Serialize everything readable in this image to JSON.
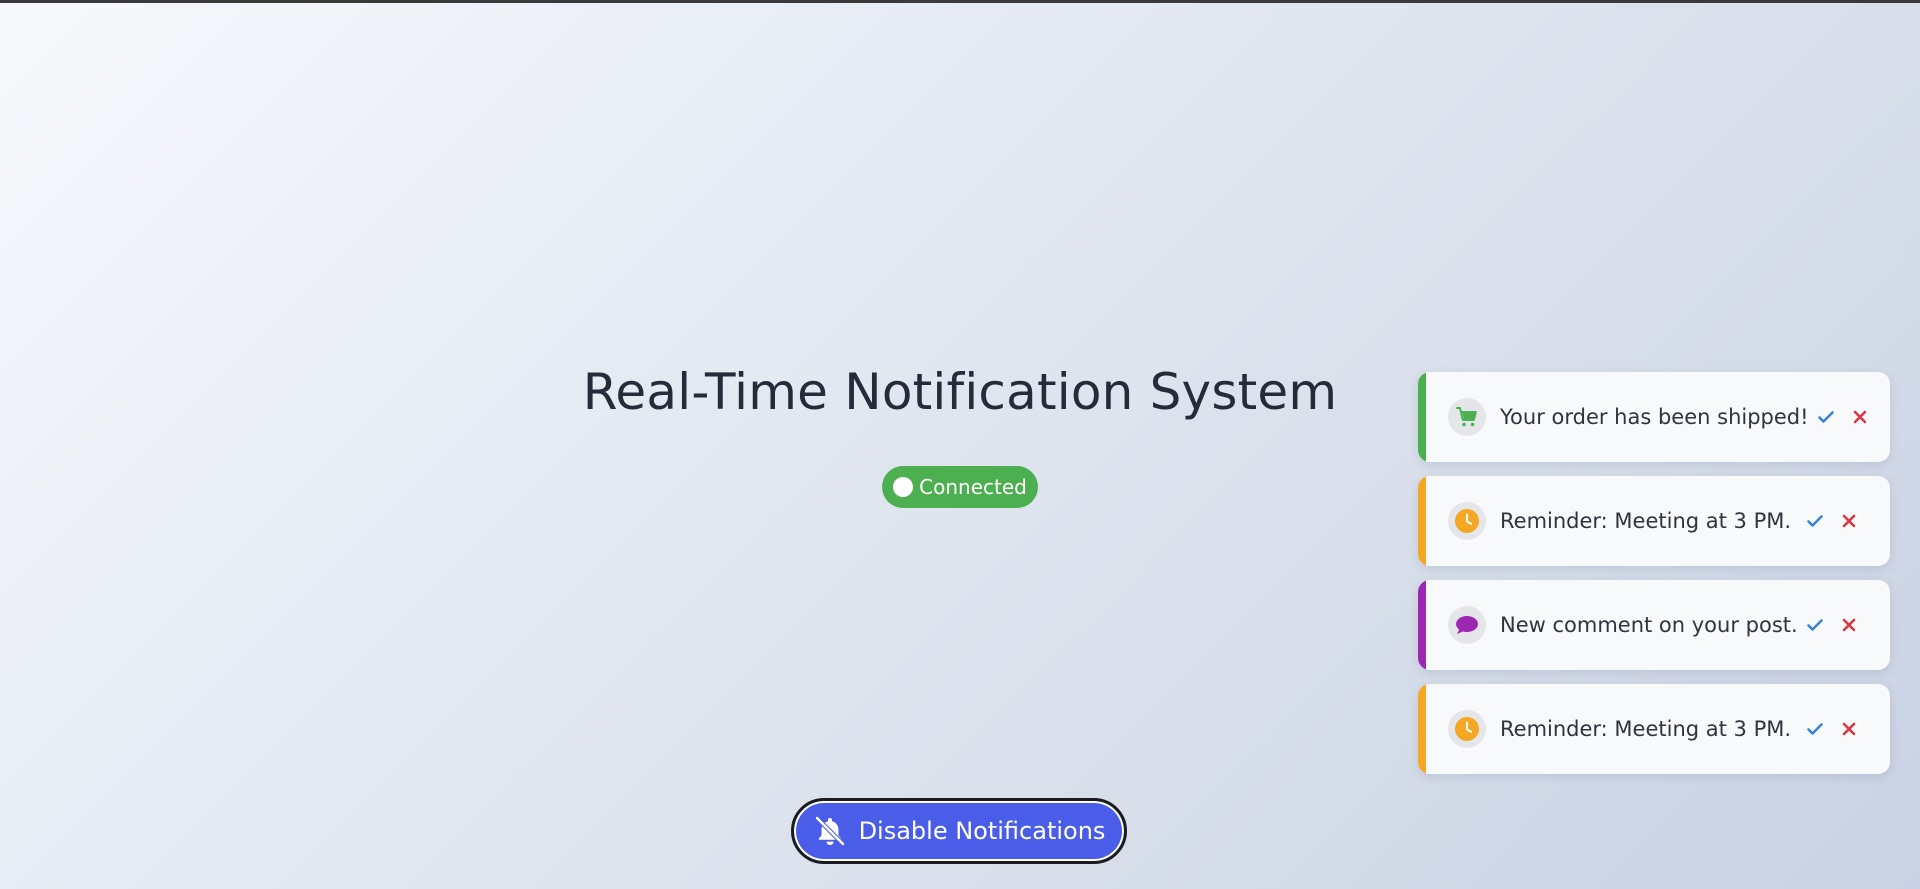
{
  "page": {
    "title": "Real-Time Notification System"
  },
  "status": {
    "label": "Connected",
    "color": "#4caf50"
  },
  "toggle": {
    "label": "Disable Notifications",
    "icon": "bell-slash-icon",
    "color": "#4a5de8"
  },
  "notifications": [
    {
      "text": "Your order has been shipped!",
      "icon": "cart-icon",
      "accent": "#4caf50"
    },
    {
      "text": "Reminder: Meeting at 3 PM.",
      "icon": "clock-icon",
      "accent": "#f5a623"
    },
    {
      "text": "New comment on your post.",
      "icon": "comment-icon",
      "accent": "#9c27b0"
    },
    {
      "text": "Reminder: Meeting at 3 PM.",
      "icon": "clock-icon",
      "accent": "#f5a623"
    }
  ],
  "actions": {
    "mark_read_icon": "check-icon",
    "dismiss_icon": "close-icon",
    "mark_read_color": "#3b82d6",
    "dismiss_color": "#dc3545"
  }
}
